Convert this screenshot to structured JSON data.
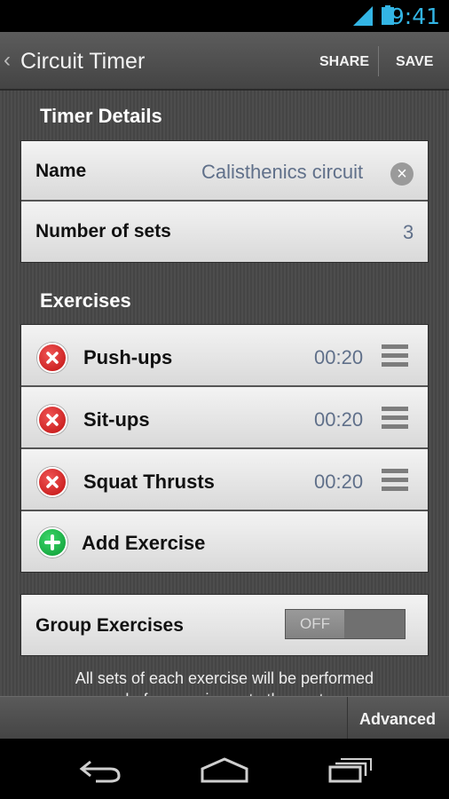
{
  "status": {
    "time": "9:41",
    "signal_icon": "signal-icon",
    "battery_icon": "battery-icon",
    "accent": "#33b5e5"
  },
  "actionbar": {
    "title": "Circuit Timer",
    "share_label": "SHARE",
    "save_label": "SAVE"
  },
  "timer_details": {
    "heading": "Timer Details",
    "name_label": "Name",
    "name_value": "Calisthenics circuit",
    "sets_label": "Number of sets",
    "sets_value": "3"
  },
  "exercises": {
    "heading": "Exercises",
    "items": [
      {
        "name": "Push-ups",
        "time": "00:20"
      },
      {
        "name": "Sit-ups",
        "time": "00:20"
      },
      {
        "name": "Squat Thrusts",
        "time": "00:20"
      }
    ],
    "add_label": "Add Exercise"
  },
  "group": {
    "label": "Group Exercises",
    "toggle_state": "OFF",
    "hint_line1": "All sets of each exercise will be performed",
    "hint_line2": "before moving onto the next"
  },
  "bottombar": {
    "advanced_label": "Advanced"
  },
  "colors": {
    "delete": "#d01818",
    "add": "#19b046",
    "value_text": "#60708a"
  }
}
